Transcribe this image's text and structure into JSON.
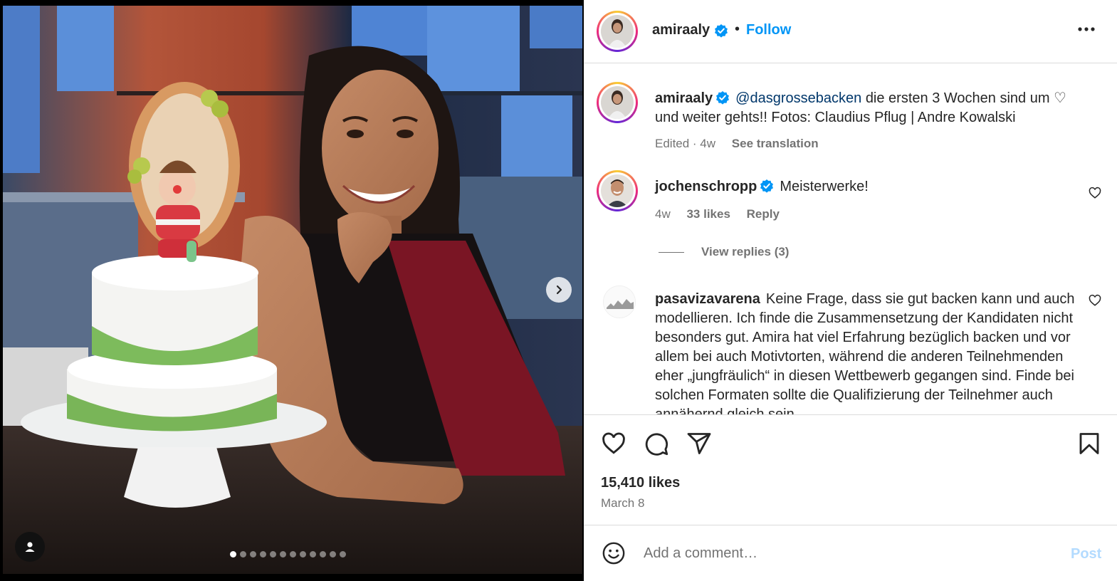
{
  "post": {
    "username": "amiraaly",
    "follow_label": "Follow",
    "separator": "•",
    "caption": {
      "mention": "@dasgrossebacken",
      "text": "die ersten 3 Wochen sind um ♡ und weiter gehts!! Fotos: Claudius Pflug | Andre Kowalski",
      "edited": "Edited · 4w",
      "see_translation": "See translation"
    },
    "likes": "15,410 likes",
    "date": "March 8"
  },
  "comments": [
    {
      "username": "jochenschropp",
      "text": "Meisterwerke!",
      "age": "4w",
      "likes": "33 likes",
      "reply_label": "Reply",
      "view_replies": "View replies (3)"
    },
    {
      "username": "pasavizavarena",
      "text": "Keine Frage, dass sie gut backen kann und auch modellieren. Ich finde die Zusammensetzung der Kandidaten nicht besonders gut. Amira hat viel Erfahrung bezüglich backen und vor allem bei auch Motivtorten, während die anderen Teilnehmenden eher „jungfräulich“ in diesen Wettbewerb gegangen sind. Finde bei solchen Formaten sollte die Qualifizierung der Teilnehmer auch annähernd gleich sein"
    }
  ],
  "add_comment": {
    "placeholder": "Add a comment…",
    "post_label": "Post"
  },
  "carousel": {
    "count": 12,
    "active_index": 0
  },
  "icons": [
    "verified-icon",
    "more-icon",
    "heart-icon",
    "comment-icon",
    "share-icon",
    "bookmark-icon",
    "emoji-icon",
    "next-arrow-icon",
    "user-tag-icon"
  ],
  "colors": {
    "accent": "#0095f6",
    "mention": "#00376b",
    "muted": "#737373",
    "post_disabled": "#b3dbff"
  }
}
